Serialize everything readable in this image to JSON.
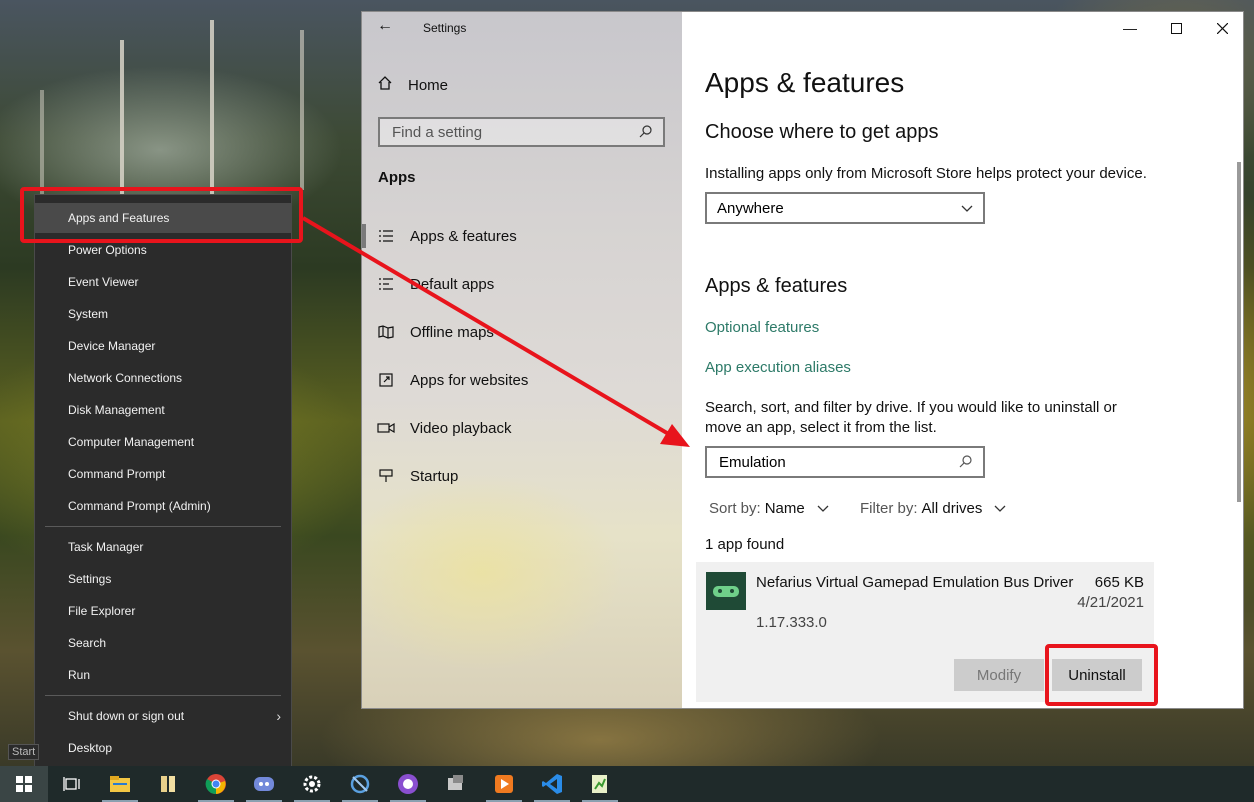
{
  "settings": {
    "title": "Settings",
    "nav": {
      "home_label": "Home",
      "search_placeholder": "Find a setting",
      "section_title": "Apps",
      "items": [
        {
          "label": "Apps & features",
          "icon": "list-icon"
        },
        {
          "label": "Default apps",
          "icon": "default-list-icon"
        },
        {
          "label": "Offline maps",
          "icon": "map-icon"
        },
        {
          "label": "Apps for websites",
          "icon": "external-link-icon"
        },
        {
          "label": "Video playback",
          "icon": "video-icon"
        },
        {
          "label": "Startup",
          "icon": "startup-icon"
        }
      ]
    },
    "content": {
      "page_title": "Apps & features",
      "choose_heading": "Choose where to get apps",
      "choose_desc": "Installing apps only from Microsoft Store helps protect your device.",
      "source_selected": "Anywhere",
      "section_heading": "Apps & features",
      "optional_features_link": "Optional features",
      "aliases_link": "App execution aliases",
      "search_desc_line1": "Search, sort, and filter by drive. If you would like to uninstall or",
      "search_desc_line2": "move an app, select it from the list.",
      "search_value": "Emulation",
      "sort_label": "Sort by:",
      "sort_value": "Name",
      "filter_label": "Filter by:",
      "filter_value": "All drives",
      "result_count": "1 app found",
      "app": {
        "name": "Nefarius Virtual Gamepad Emulation Bus Driver",
        "size": "665 KB",
        "date": "4/21/2021",
        "version": "1.17.333.0",
        "modify_label": "Modify",
        "uninstall_label": "Uninstall"
      }
    }
  },
  "winx_menu": {
    "items": [
      "Apps and Features",
      "Power Options",
      "Event Viewer",
      "System",
      "Device Manager",
      "Network Connections",
      "Disk Management",
      "Computer Management",
      "Command Prompt",
      "Command Prompt (Admin)",
      "Task Manager",
      "Settings",
      "File Explorer",
      "Search",
      "Run",
      "Shut down or sign out",
      "Desktop"
    ]
  },
  "taskbar": {
    "start_tooltip": "Start",
    "apps": [
      "task-view-icon",
      "file-explorer-icon",
      "folder-icon",
      "chrome-icon",
      "discord-icon",
      "settings-icon",
      "dev-tool-icon",
      "github-desktop-icon",
      "virtualbox-icon",
      "media-player-icon",
      "vscode-icon",
      "notepad-plus-icon"
    ]
  },
  "colors": {
    "annotation_red": "#e8141c",
    "link_teal": "#2d7a68",
    "menu_bg": "#2b2b2b"
  }
}
